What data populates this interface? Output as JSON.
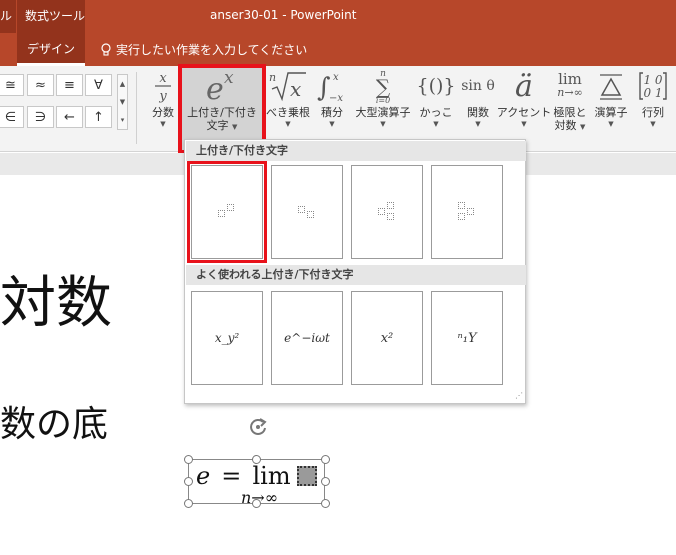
{
  "titlebar": {
    "context_left": "ル",
    "context_tool": "数式ツール",
    "title": "anser30-01  -  PowerPoint"
  },
  "tabs": {
    "active": "デザイン",
    "tell_me": "実行したい作業を入力してください"
  },
  "symbols": {
    "row1": [
      "≅",
      "≈",
      "≡",
      "∀"
    ],
    "row2": [
      "∈",
      "∋",
      "←",
      "↑"
    ]
  },
  "ribbon": {
    "fraction": {
      "label": "分数"
    },
    "script": {
      "label_1": "上付き/下付き",
      "label_2": "文字"
    },
    "radical": {
      "label": "べき乗根"
    },
    "integral": {
      "label": "積分"
    },
    "large_operator": {
      "label": "大型演算子"
    },
    "bracket": {
      "label": "かっこ"
    },
    "function": {
      "label": "関数",
      "glyph": "sin θ"
    },
    "accent": {
      "label": "アクセント"
    },
    "limit": {
      "label_1": "極限と",
      "label_2": "対数",
      "glyph_top": "lim",
      "glyph_bottom": "n→∞"
    },
    "operator": {
      "label": "演算子"
    },
    "matrix": {
      "label": "行列"
    }
  },
  "gallery": {
    "section1": "上付き/下付き文字",
    "section2": "よく使われる上付き/下付き文字",
    "common": [
      "x_y²",
      "e^−iωt",
      "x²",
      "ⁿ₁Y"
    ]
  },
  "slide": {
    "text1": "対数",
    "text2": "数の底"
  },
  "equation": {
    "e": "e",
    "eq": "=",
    "lim": "lim",
    "sub": "n→∞"
  },
  "colors": {
    "titlebar": "#b7472a",
    "context_tab": "#93331c",
    "highlight_red": "#e8121b"
  }
}
